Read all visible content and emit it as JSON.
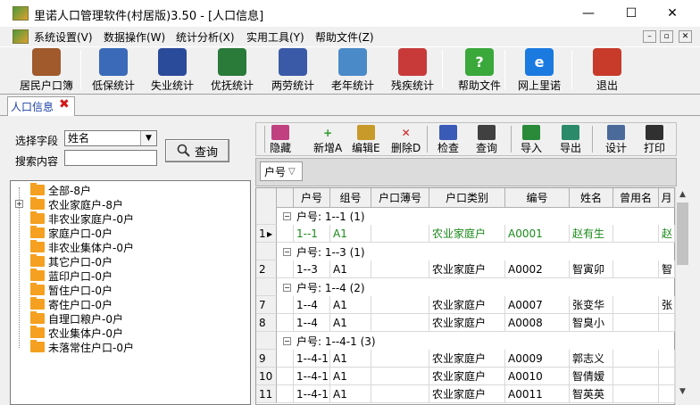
{
  "window": {
    "title": "里诺人口管理软件(村居版)3.50 - [人口信息]",
    "min": "—",
    "max": "☐",
    "close": "✕"
  },
  "menu": {
    "items": [
      "系统设置(V)",
      "数据操作(W)",
      "统计分析(X)",
      "实用工具(Y)",
      "帮助文件(Z)"
    ],
    "mdi": [
      "–",
      "▫",
      "✕"
    ]
  },
  "toolbar": {
    "items": [
      {
        "label": "居民户口簿",
        "icon": "household-book-icon",
        "color": "#a05a2c"
      },
      {
        "label": "低保统计",
        "icon": "farmer-person-icon",
        "color": "#3a6ab8"
      },
      {
        "label": "失业统计",
        "icon": "worker-person-icon",
        "color": "#2a4a9a"
      },
      {
        "label": "优抚统计",
        "icon": "soldier-person-icon",
        "color": "#2a7a3a"
      },
      {
        "label": "两劳统计",
        "icon": "police-person-icon",
        "color": "#3a5aa8"
      },
      {
        "label": "老年统计",
        "icon": "elder-person-icon",
        "color": "#4a8ac8"
      },
      {
        "label": "残疾统计",
        "icon": "disabled-person-icon",
        "color": "#c83a3a"
      },
      {
        "label": "帮助文件",
        "icon": "help-question-icon",
        "color": "#3aa83a",
        "glyph": "?"
      },
      {
        "label": "网上里诺",
        "icon": "internet-explorer-icon",
        "color": "#1a7ae0",
        "glyph": "e"
      },
      {
        "label": "退出",
        "icon": "exit-door-icon",
        "color": "#c83a2a"
      }
    ]
  },
  "tab": {
    "label": "人口信息",
    "close": "✖"
  },
  "search": {
    "field_label": "选择字段",
    "field_value": "姓名",
    "content_label": "搜索内容",
    "content_value": "",
    "query_label": "查询"
  },
  "tree": {
    "items": [
      "全部-8户",
      "农业家庭户-8户",
      "非农业家庭户-0户",
      "家庭户口-0户",
      "非农业集体户-0户",
      "其它户口-0户",
      "蓝印户口-0户",
      "暂住户口-0户",
      "寄住户口-0户",
      "自理口粮户-0户",
      "农业集体户-0户",
      "未落常住户口-0户"
    ],
    "expander": "+"
  },
  "grid_toolbar": {
    "items": [
      {
        "label": "隐藏",
        "icon": "hide-icon",
        "color": "#c04080"
      },
      {
        "label": "新增A",
        "icon": "add-plus-icon",
        "color": "#2a9a2a",
        "glyph": "+"
      },
      {
        "label": "编辑E",
        "icon": "edit-pencil-icon",
        "color": "#c89a2a"
      },
      {
        "label": "删除D",
        "icon": "delete-x-icon",
        "color": "#d02020",
        "glyph": "✕"
      },
      {
        "label": "检查",
        "icon": "check-disk-icon",
        "color": "#3a5ab8"
      },
      {
        "label": "查询",
        "icon": "binoculars-icon",
        "color": "#404040"
      },
      {
        "label": "导入",
        "icon": "import-excel-icon",
        "color": "#2a8a3a"
      },
      {
        "label": "导出",
        "icon": "export-excel-icon",
        "color": "#2a8a6a"
      },
      {
        "label": "设计",
        "icon": "design-tools-icon",
        "color": "#4a6a9a"
      },
      {
        "label": "打印",
        "icon": "printer-icon",
        "color": "#303030"
      }
    ]
  },
  "group_by": {
    "chip": "户号",
    "arrow": "▽"
  },
  "grid": {
    "columns": [
      "户号",
      "组号",
      "户口薄号",
      "户口类别",
      "编号",
      "姓名",
      "曾用名",
      "月"
    ],
    "rows": [
      {
        "type": "group",
        "text": "户号: 1--1 (1)"
      },
      {
        "type": "data",
        "num": "1",
        "indicator": "▶",
        "cells": [
          "1--1",
          "A1",
          "",
          "农业家庭户",
          "A0001",
          "赵有生",
          "",
          "赵"
        ],
        "highlight": true
      },
      {
        "type": "group",
        "text": "户号: 1--3 (1)"
      },
      {
        "type": "data",
        "num": "2",
        "cells": [
          "1--3",
          "A1",
          "",
          "农业家庭户",
          "A0002",
          "智寅卯",
          "",
          "智"
        ]
      },
      {
        "type": "group",
        "text": "户号: 1--4 (2)"
      },
      {
        "type": "data",
        "num": "7",
        "cells": [
          "1--4",
          "A1",
          "",
          "农业家庭户",
          "A0007",
          "张变华",
          "",
          "张"
        ]
      },
      {
        "type": "data",
        "num": "8",
        "cells": [
          "1--4",
          "A1",
          "",
          "农业家庭户",
          "A0008",
          "智臭小",
          "",
          ""
        ]
      },
      {
        "type": "group",
        "text": "户号: 1--4-1 (3)"
      },
      {
        "type": "data",
        "num": "9",
        "cells": [
          "1--4-1",
          "A1",
          "",
          "农业家庭户",
          "A0009",
          "郭志义",
          "",
          ""
        ]
      },
      {
        "type": "data",
        "num": "10",
        "cells": [
          "1--4-1",
          "A1",
          "",
          "农业家庭户",
          "A0010",
          "智倩嫒",
          "",
          ""
        ]
      },
      {
        "type": "data",
        "num": "11",
        "cells": [
          "1--4-1",
          "A1",
          "",
          "农业家庭户",
          "A0011",
          "智英英",
          "",
          ""
        ]
      }
    ]
  }
}
